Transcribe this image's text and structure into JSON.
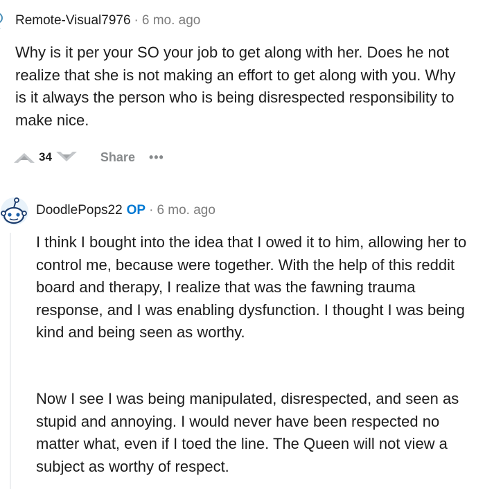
{
  "comments": [
    {
      "username": "Remote-Visual7976",
      "separator": "·",
      "time": "6 mo. ago",
      "paragraphs": [
        "Why is it per your SO your job to get along with her. Does he not realize that she is not making an effort to get along with you. Why is it always the person who is being disrespected responsibility to make nice."
      ],
      "score": "34",
      "share_label": "Share",
      "more_label": "•••"
    },
    {
      "username": "DoodlePops22",
      "op_badge": "OP",
      "separator": "·",
      "time": "6 mo. ago",
      "paragraphs": [
        "I think I bought into the idea that I owed it to him, allowing her to control me, because were together. With the help of this reddit board and therapy, I realize that was the fawning trauma response, and I was enabling dysfunction. I thought I was being kind and being seen as worthy.",
        "Now I see I was being manipulated, disrespected, and seen as stupid and annoying. I would never have been respected no matter what, even if I toed the line. The Queen will not view a subject as worthy of respect."
      ]
    }
  ],
  "icons": {
    "top_avatar": "snoo-avatar-icon",
    "op_avatar": "snoo-avatar-icon",
    "upvote": "upvote-arrow-icon",
    "downvote": "downvote-arrow-icon"
  },
  "colors": {
    "op_badge": "#0079d3",
    "meta_text": "#7c7c7c",
    "action_gray": "#878a8c",
    "thread_line": "#edeff1"
  }
}
